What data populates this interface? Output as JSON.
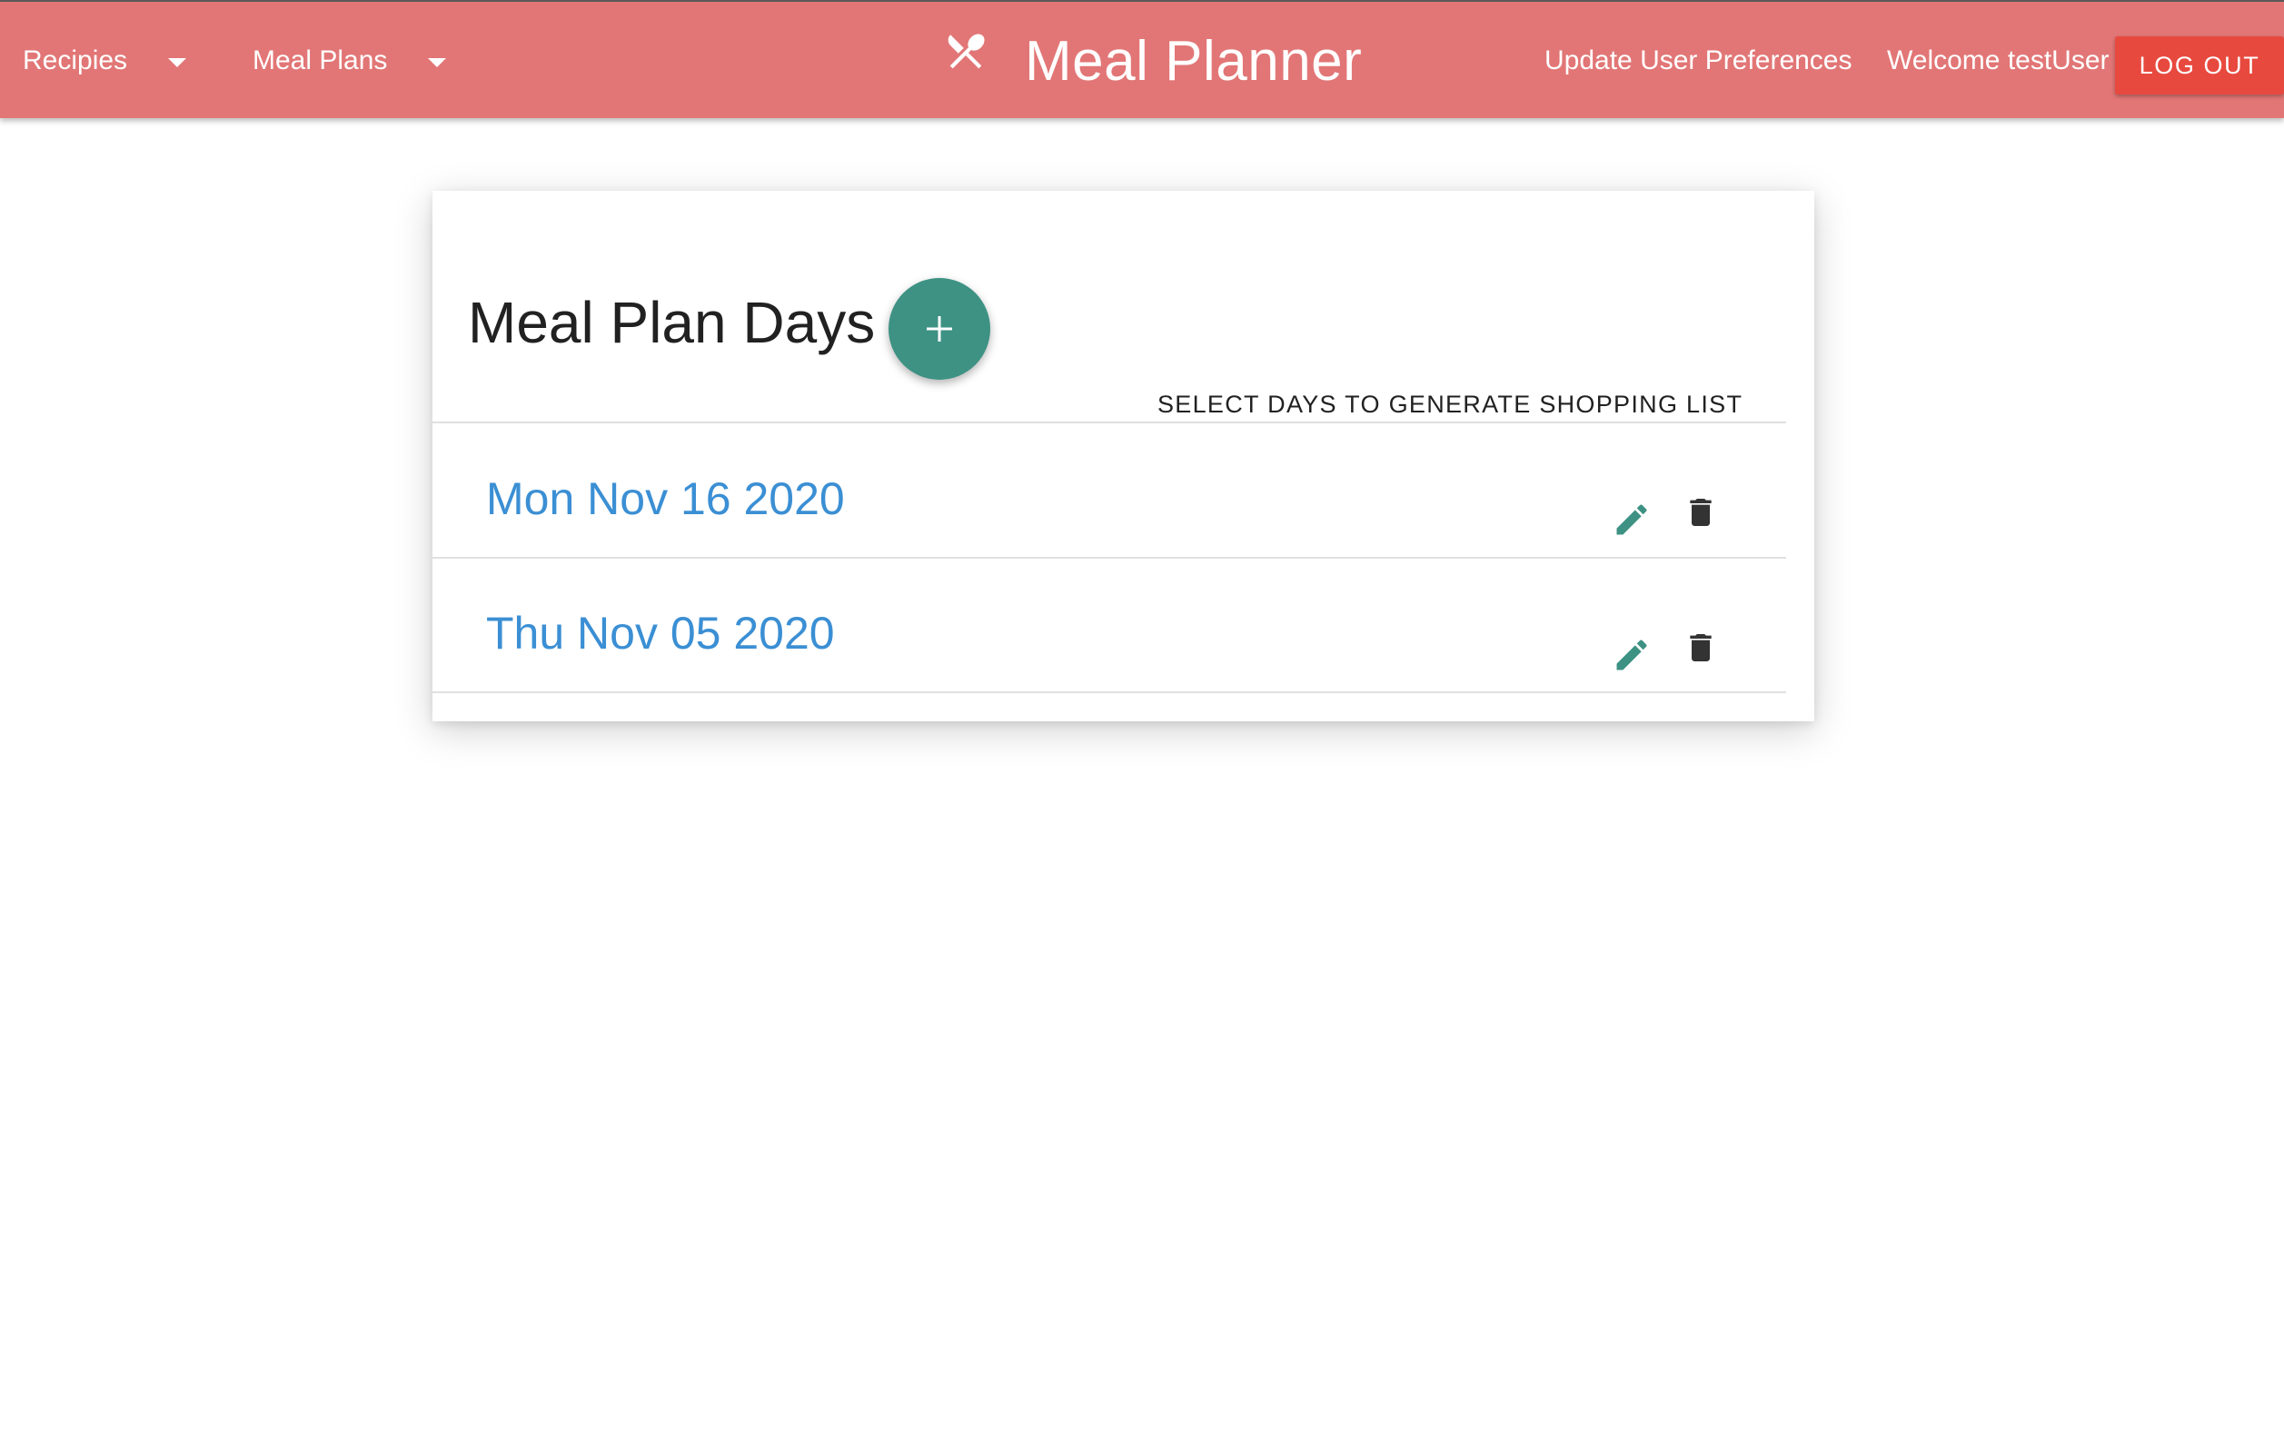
{
  "header": {
    "recipes_label": "Recipies",
    "meal_plans_label": "Meal Plans",
    "app_title": "Meal Planner",
    "brand_icon": "utensils-crossed-icon",
    "preferences_label": "Update User Preferences",
    "welcome_text": "Welcome testUser",
    "logout_label": "LOG OUT",
    "bar_color": "#e27676",
    "logout_color": "#e8493e"
  },
  "main": {
    "title": "Meal Plan Days",
    "add_icon": "plus-icon",
    "shopping_button_label": "SELECT DAYS TO GENERATE SHOPPING LIST",
    "accent_color": "#3d9284",
    "days": [
      {
        "label": "Mon Nov 16 2020",
        "edit_icon": "pencil-icon",
        "delete_icon": "trash-icon"
      },
      {
        "label": "Thu Nov 05 2020",
        "edit_icon": "pencil-icon",
        "delete_icon": "trash-icon"
      }
    ]
  }
}
